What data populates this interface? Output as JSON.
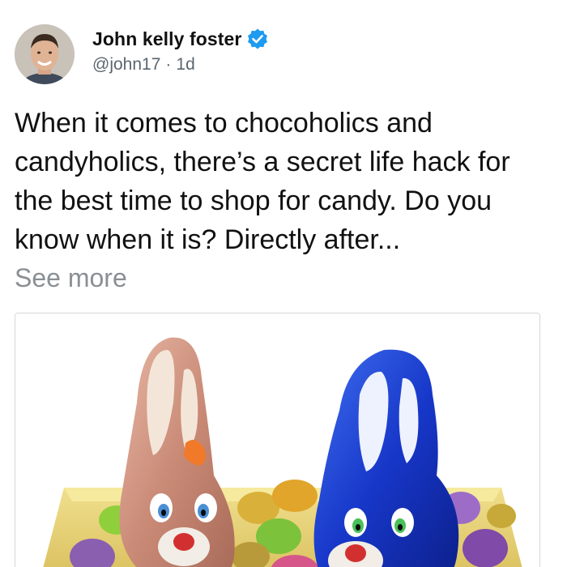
{
  "post": {
    "author_name": "John kelly foster",
    "handle": "@john17",
    "separator": "·",
    "time": "1d",
    "text": "When it comes to chocoholics and candyholics, there’s a secret life hack for the best time to shop for candy. Do you know when it is? Directly after...",
    "see_more": "See more",
    "icons": {
      "verified": "verified-badge-icon",
      "avatar": "avatar"
    },
    "colors": {
      "verified": "#1d9bf0",
      "see_more": "#8a8f94",
      "handle": "#5b6670"
    }
  }
}
